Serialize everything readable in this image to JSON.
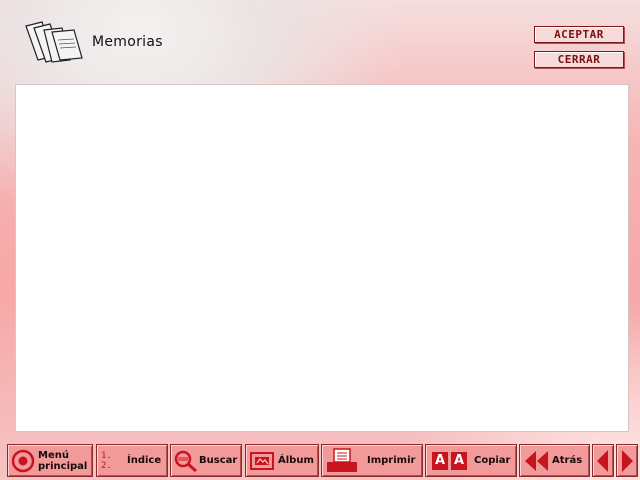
{
  "header": {
    "title": "Memorias",
    "icon": "documents-stack-icon",
    "accept_label": "ACEPTAR",
    "close_label": "CERRAR"
  },
  "toolbar": {
    "main_menu_line1": "Menú",
    "main_menu_line2": "principal",
    "index_label": "Índice",
    "index_icon_text_1": "1.",
    "index_icon_text_2": "2.",
    "search_label": "Buscar",
    "album_label": "Álbum",
    "print_label": "Imprimir",
    "copy_label": "Copiar",
    "copy_icon_letter": "A",
    "back_label": "Atrás"
  },
  "colors": {
    "accent": "#c8141e",
    "button_face": "#f29a9a",
    "border": "#8a2a2a",
    "content_bg": "#ffffff"
  }
}
